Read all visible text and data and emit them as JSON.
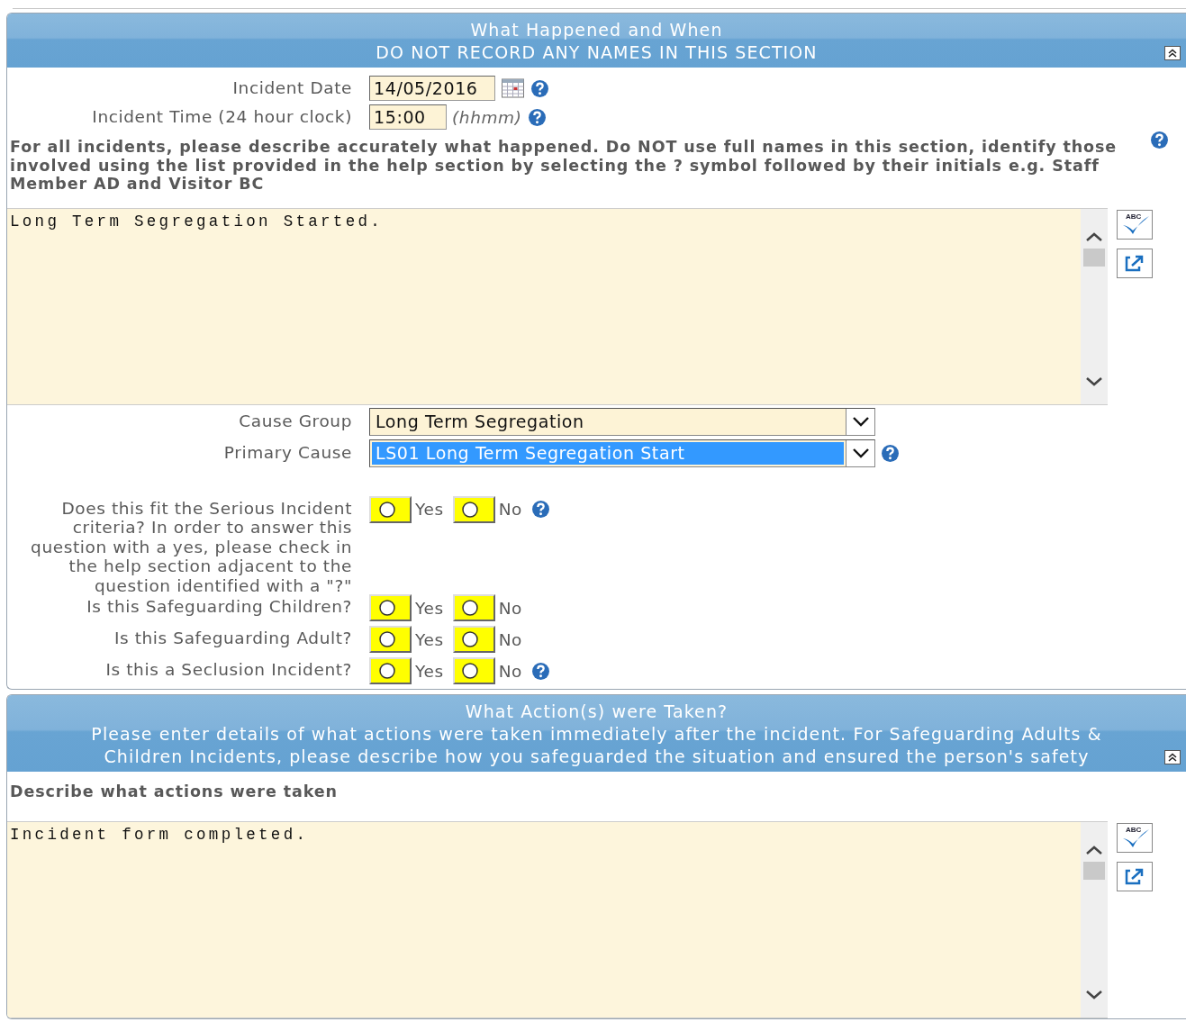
{
  "sections": [
    {
      "title": "What Happened and When",
      "subtitle": "DO NOT RECORD ANY NAMES IN THIS SECTION",
      "items": [
        {
          "kind": "date",
          "label": "Incident Date",
          "value": "14/05/2016",
          "help": true
        },
        {
          "kind": "time",
          "label": "Incident Time (24 hour clock)",
          "value": "15:00",
          "hint": "(hhmm)",
          "help": true
        },
        {
          "kind": "instruction",
          "text": "For all incidents, please describe accurately what happened. Do NOT use full names in this section, identify those involved using the list provided in the help section by selecting the ? symbol followed by their initials e.g. Staff Member AD and Visitor BC",
          "help": true
        },
        {
          "kind": "textarea",
          "value": "Long Term Segregation Started.",
          "spellcheck_label": "ABC"
        },
        {
          "kind": "select",
          "label": "Cause Group",
          "value": "Long Term Segregation",
          "highlighted": false,
          "help": false
        },
        {
          "kind": "select",
          "label": "Primary Cause",
          "value": "LS01 Long Term Segregation Start",
          "highlighted": true,
          "help": true
        },
        {
          "kind": "radio",
          "label": "Does this fit the Serious Incident criteria? In order to answer this question with a yes, please check in the help section adjacent to the question identified with a \"?\"",
          "options": [
            {
              "label": "Yes",
              "selected": false
            },
            {
              "label": "No",
              "selected": false
            }
          ],
          "help": true
        },
        {
          "kind": "radio",
          "label": "Is this Safeguarding Children?",
          "options": [
            {
              "label": "Yes",
              "selected": false
            },
            {
              "label": "No",
              "selected": false
            }
          ],
          "help": false
        },
        {
          "kind": "radio",
          "label": "Is this Safeguarding Adult?",
          "options": [
            {
              "label": "Yes",
              "selected": false
            },
            {
              "label": "No",
              "selected": false
            }
          ],
          "help": false
        },
        {
          "kind": "radio",
          "label": "Is this a Seclusion Incident?",
          "options": [
            {
              "label": "Yes",
              "selected": false
            },
            {
              "label": "No",
              "selected": false
            }
          ],
          "help": true
        }
      ]
    },
    {
      "title": "What Action(s) were Taken?",
      "subtitle": "Please enter details of what actions were taken immediately after the incident. For Safeguarding Adults & Children Incidents, please describe how you safeguarded the situation and ensured the person's safety",
      "items": [
        {
          "kind": "instruction",
          "text": "Describe what actions were taken",
          "help": false
        },
        {
          "kind": "textarea",
          "value": "Incident form completed.",
          "spellcheck_label": "ABC"
        }
      ]
    }
  ]
}
